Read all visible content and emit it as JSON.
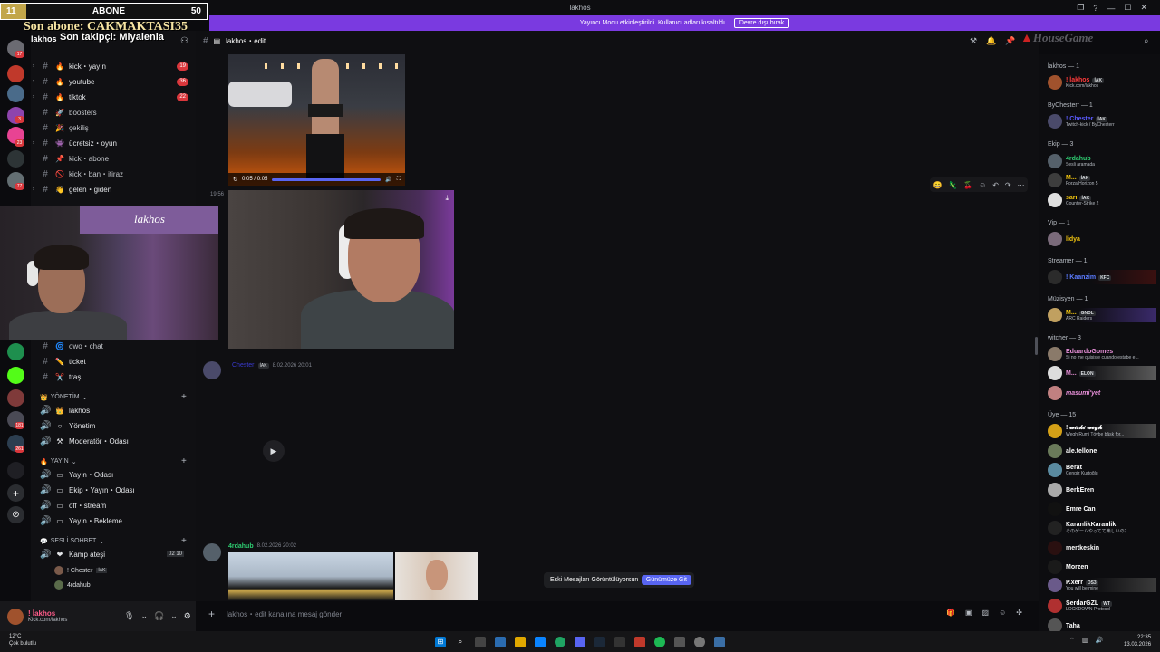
{
  "titlebar": {
    "title": "lakhos"
  },
  "window_controls": [
    "❐",
    "?",
    "—",
    "☐",
    "✕"
  ],
  "banner": {
    "text": "Yayıncı Modu etkinleştirildi. Kullanıcı adları kısaltıldı.",
    "button": "Devre dışı bırak"
  },
  "overlay": {
    "left_value": "11",
    "label": "ABONE",
    "right_value": "50",
    "last_sub": "Son abone: CAKMAKTASI35",
    "last_follower": "Son takipçi: Miyalenia"
  },
  "server": {
    "name": "lakhos"
  },
  "guild_badges": [
    "17",
    "3",
    "2",
    "23",
    "77",
    "181",
    "261"
  ],
  "channels": [
    {
      "emoji": "🔥",
      "name": "kick・yayın",
      "count": "19",
      "arrow": "›"
    },
    {
      "emoji": "🔥",
      "name": "youtube",
      "count": "36",
      "arrow": "›"
    },
    {
      "emoji": "🔥",
      "name": "tiktok",
      "count": "22",
      "arrow": "›"
    },
    {
      "emoji": "🚀",
      "name": "boosters"
    },
    {
      "emoji": "🎉",
      "name": "çekiliş"
    },
    {
      "emoji": "👾",
      "name": "ücretsiz・oyun",
      "arrow": "›"
    },
    {
      "emoji": "📌",
      "name": "kick・abone"
    },
    {
      "emoji": "🚫",
      "name": "kick・ban・itiraz"
    },
    {
      "emoji": "👋",
      "name": "gelen・giden",
      "arrow": "›"
    }
  ],
  "channels_lower": [
    {
      "emoji": "🌀",
      "name": "owo・chat"
    },
    {
      "emoji": "✏️",
      "name": "ticket"
    },
    {
      "emoji": "✂️",
      "name": "traş"
    }
  ],
  "cat_yonetim": {
    "label": "YÖNETİM",
    "items": [
      "lakhos",
      "Yönetim",
      "Moderatör・Odası"
    ]
  },
  "cat_yayin": {
    "label": "YAYIN",
    "items": [
      "Yayın・Odası",
      "Ekip・Yayın・Odası",
      "off・stream",
      "Yayın・Bekleme"
    ]
  },
  "cat_sesli": {
    "label": "SESLİ SOHBET",
    "room": "Kamp ateşi",
    "counter": "02 10",
    "users": [
      {
        "name": "! Chester",
        "tag": "İAK"
      },
      {
        "name": "4rdahub"
      }
    ]
  },
  "webcam": {
    "sign": "lakhos"
  },
  "header": {
    "channel": "lakhos・edit"
  },
  "logo": "HouseGame",
  "video1": {
    "time": "0:05 / 0:05"
  },
  "message_time": "19:56",
  "message1": {
    "author": "Chester",
    "tag": "İAK",
    "date": "8.02.2026 20:01"
  },
  "message2": {
    "author": "4rdahub",
    "date": "8.02.2026 20:02"
  },
  "old_messages": {
    "text": "Eski Mesajları Görüntülüyorsun",
    "button": "Günümüze Git"
  },
  "input": {
    "placeholder": "lakhos・edit kanalına mesaj gönder"
  },
  "userpanel": {
    "name": "! İakhos",
    "status": "Kick.com/lakhos"
  },
  "members": {
    "cat1": "lakhos — 1",
    "m1": {
      "name": "! İakhos",
      "tag": "İAK",
      "status": "Kick.com/lakhos",
      "color": "#ff3b3b"
    },
    "cat2": "ByChesterr — 1",
    "m2": {
      "name": "! Chester",
      "tag": "İAK",
      "status": "Twitch-kick / ByChesterr",
      "color": "#3a3ad0"
    },
    "cat3": "Ekip — 3",
    "m3": {
      "name": "4rdahub",
      "status": "Sesli aramada",
      "color": "#2ecc71"
    },
    "m4": {
      "name": "M...",
      "tag": "İAK",
      "status": "Forza Horizon 5",
      "color": "#f1c40f"
    },
    "m5": {
      "name": "sarı",
      "tag": "İAK",
      "status": "Counter-Strike 2",
      "color": "#f1c40f"
    },
    "cat4": "Vip — 1",
    "m6": {
      "name": "lidya",
      "color": "#f1c40f"
    },
    "cat5": "Streamer — 1",
    "m7": {
      "name": "! Kaanzim",
      "tag": "KFC",
      "color": "#5b7bff"
    },
    "cat6": "Müzisyen — 1",
    "m8": {
      "name": "M...",
      "tag": "GNDL",
      "status": "ARC Raiders",
      "color": "#f1c40f"
    },
    "cat7": "witcher — 3",
    "m9": {
      "name": "EduardoGomes",
      "status": "Si no me quisiste cuando estabe e...",
      "color": "#e890d9"
    },
    "m10": {
      "name": "M...",
      "tag": "ELON",
      "color": "#e890d9"
    },
    "m11": {
      "name": "masumi'yet",
      "color": "#e890d9"
    },
    "cat8": "Üye — 15",
    "m12": {
      "name": "! 𝔀𝓲𝓼𝓴𝓲 𝔀𝓮𝓰𝓱",
      "status": "Wegh Rumi Tövbe bâşk for...",
      "color": "#ffffff"
    },
    "m13": {
      "name": "ale.tellone",
      "color": "#ffffff"
    },
    "m14": {
      "name": "Berat",
      "status": "Cengiz Kurtoğlu",
      "color": "#ffffff"
    },
    "m15": {
      "name": "BerkEren",
      "color": "#ffffff"
    },
    "m16": {
      "name": "Emre Can",
      "color": "#ffffff"
    },
    "m17": {
      "name": "KaranlikKaranlik",
      "status": "そのゲームやってて楽しいの？",
      "color": "#ffffff"
    },
    "m18": {
      "name": "mertkeskin",
      "color": "#ffffff"
    },
    "m19": {
      "name": "Morzen",
      "color": "#ffffff"
    },
    "m20": {
      "name": "P.xerr",
      "tag": "DS3",
      "status": "You will be mine",
      "color": "#ffffff"
    },
    "m21": {
      "name": "SerdarGZL",
      "tag": "WT",
      "status": "LOCKDOWN Protocol",
      "color": "#ffffff"
    },
    "m22": {
      "name": "Taha",
      "color": "#ffffff"
    }
  },
  "taskbar": {
    "weather_temp": "12°C",
    "weather_desc": "Çok bulutlu",
    "time": "22:35",
    "date": "13.03.2026"
  }
}
